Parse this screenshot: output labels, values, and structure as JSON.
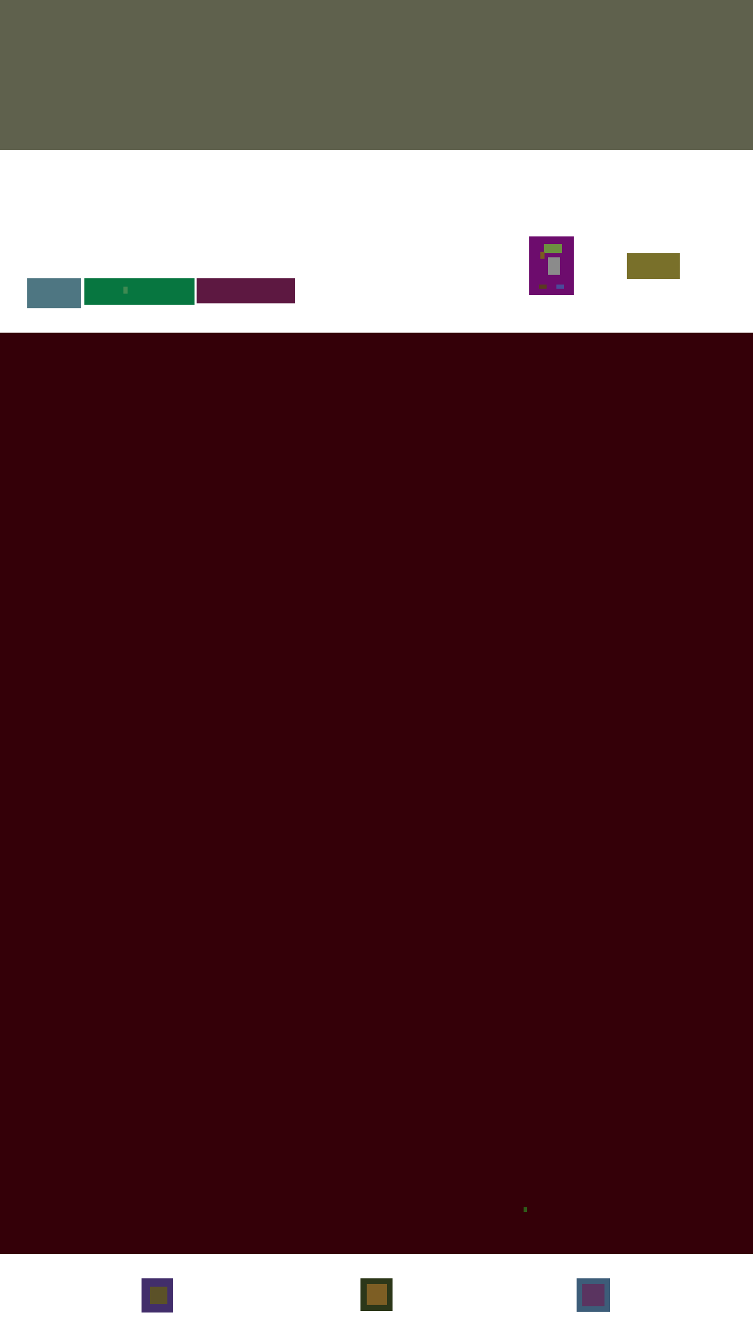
{
  "colors": {
    "status_area": "#5f614d",
    "content_area": "#340008",
    "tab_1": "#4e7682",
    "tab_2": "#077640",
    "tab_2_mark": "#3f8a52",
    "tab_3": "#5d1841",
    "profile_card": "#6d0c6d",
    "profile_card_banner": "#6d9040",
    "profile_card_flag": "#7a5a20",
    "profile_card_body": "#8b8b8b",
    "profile_card_foot_left": "#5a3a20",
    "profile_card_foot_right": "#4a4a9a",
    "action_button": "#79702a",
    "content_dot": "#2f5a1a",
    "nav_1": "#422e6b",
    "nav_1_inner": "#5b5128",
    "nav_2": "#2c3719",
    "nav_2_inner": "#7d5e24",
    "nav_3": "#3d5d79",
    "nav_3_inner": "#5a3460"
  }
}
